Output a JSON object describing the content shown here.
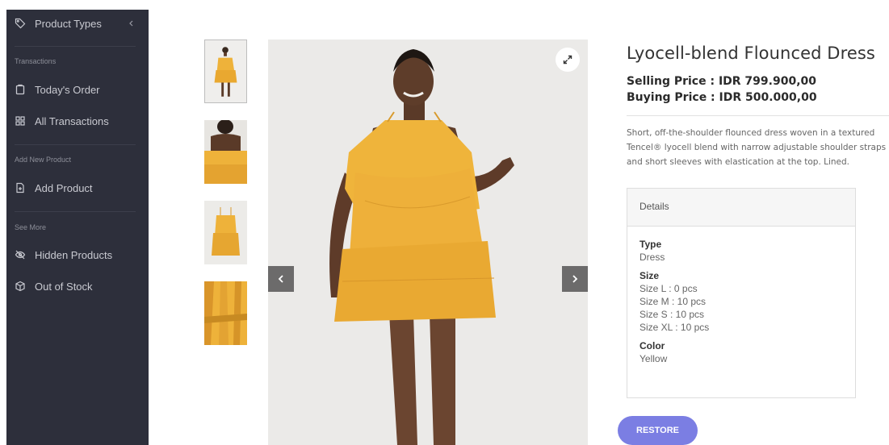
{
  "sidebar": {
    "product_types": "Product Types",
    "sections": {
      "transactions": "Transactions",
      "add_new_product": "Add New Product",
      "see_more": "See More"
    },
    "items": {
      "todays_order": "Today's Order",
      "all_transactions": "All Transactions",
      "add_product": "Add Product",
      "hidden_products": "Hidden Products",
      "out_of_stock": "Out of Stock"
    }
  },
  "product": {
    "title": "Lyocell-blend Flounced Dress",
    "selling_price": "Selling Price : IDR 799.900,00",
    "buying_price": "Buying Price : IDR 500.000,00",
    "description": "Short, off-the-shoulder flounced dress woven in a textured Tencel® lyocell blend with narrow adjustable shoulder straps and short sleeves with elastication at the top. Lined.",
    "details": {
      "header": "Details",
      "type_label": "Type",
      "type_value": "Dress",
      "size_label": "Size",
      "sizes": [
        "Size L : 0 pcs",
        "Size M : 10 pcs",
        "Size S : 10 pcs",
        "Size XL : 10 pcs"
      ],
      "color_label": "Color",
      "color_value": "Yellow"
    },
    "restore_label": "RESTORE"
  },
  "colors": {
    "sidebar_bg": "#2d2f3b",
    "accent": "#7b7ee3",
    "dress": "#eeb23a"
  },
  "icons": {
    "product_types": "tag-icon",
    "collapse": "chevron-left-icon",
    "todays_order": "clipboard-icon",
    "all_transactions": "grid-icon",
    "add_product": "file-plus-icon",
    "hidden_products": "eye-off-icon",
    "out_of_stock": "package-icon",
    "expand": "expand-icon",
    "prev": "chevron-left-icon",
    "next": "chevron-right-icon"
  }
}
